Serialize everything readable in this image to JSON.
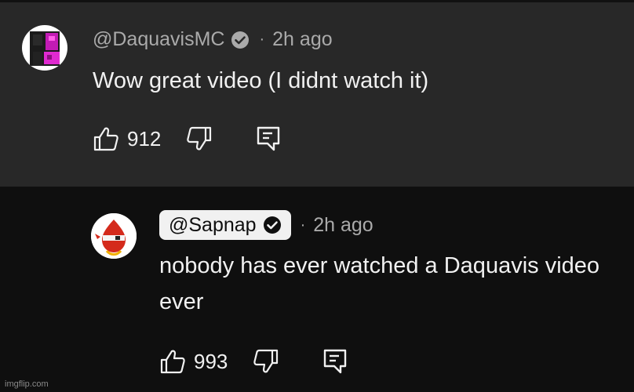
{
  "comments": [
    {
      "handle": "@DaquavisMC",
      "verified": true,
      "time": "2h ago",
      "text": "Wow great video (I didnt watch it)",
      "likes": "912"
    },
    {
      "handle": "@Sapnap",
      "verified": true,
      "time": "2h ago",
      "text": "nobody has ever watched a Daquavis video ever",
      "likes": "993"
    }
  ],
  "separator": "·",
  "icons": {
    "like": "thumbs-up-icon",
    "dislike": "thumbs-down-icon",
    "reply": "reply-icon",
    "verified": "verified-check-icon"
  },
  "colors": {
    "parent_bg": "#282828",
    "reply_bg": "#0f0f0f",
    "meta_text": "#aaaaaa",
    "main_text": "#f1f1f1",
    "highlight_pill": "#f1f1f1"
  },
  "watermark": "imgflip.com"
}
